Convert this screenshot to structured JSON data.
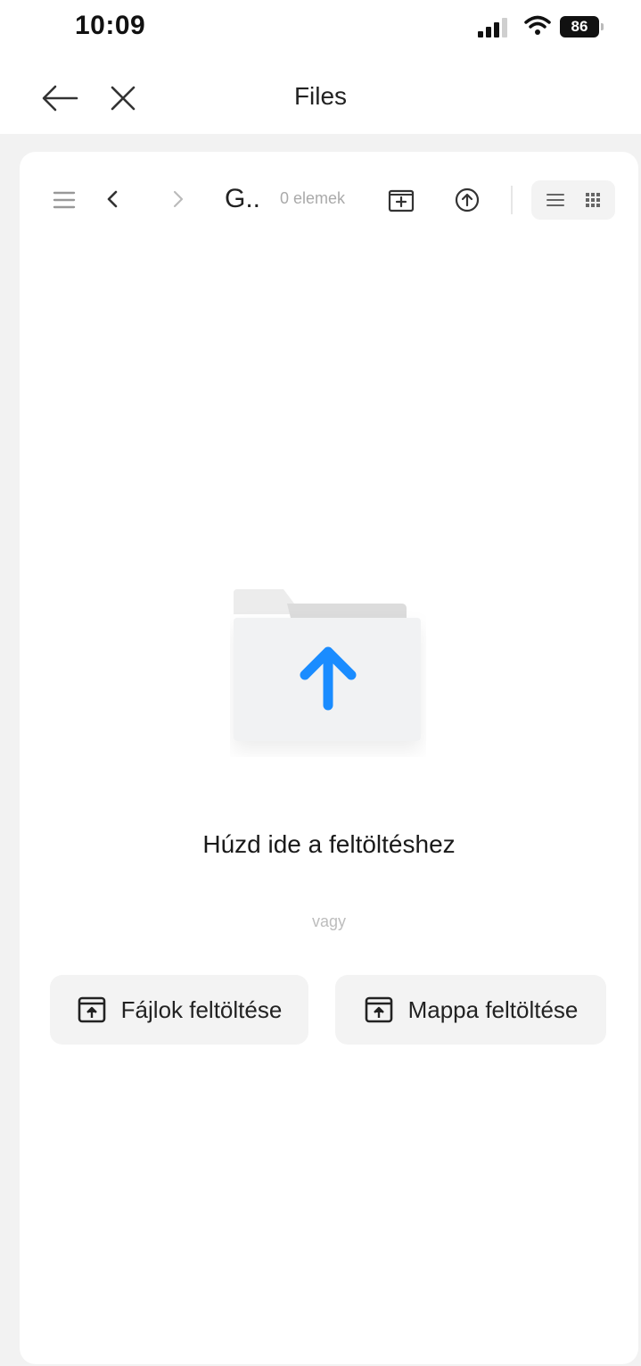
{
  "status_bar": {
    "time": "10:09",
    "battery": "86",
    "icons": [
      "signal-icon",
      "wifi-icon",
      "battery-icon"
    ]
  },
  "nav": {
    "title": "Files",
    "back_icon": "arrow-left-icon",
    "close_icon": "close-icon"
  },
  "toolbar": {
    "folder_name": "G..",
    "item_count": "0 elemek",
    "icons": [
      "menu-icon",
      "chevron-left-icon",
      "chevron-right-icon",
      "new-folder-icon",
      "upload-icon",
      "list-view-icon",
      "grid-view-icon"
    ]
  },
  "empty_state": {
    "title": "Húzd ide a feltöltéshez",
    "or_text": "vagy",
    "upload_files_label": "Fájlok feltöltése",
    "upload_folder_label": "Mappa feltöltése",
    "illustration": "folder-upload-illustration"
  },
  "colors": {
    "accent": "#1a8cff",
    "background": "#f2f2f2",
    "card": "#ffffff"
  }
}
